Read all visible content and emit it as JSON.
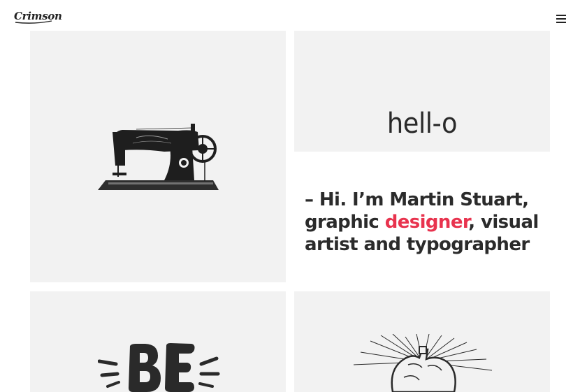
{
  "header": {
    "logo_text": "Crimson",
    "menu_icon": "hamburger-menu-icon"
  },
  "tiles": {
    "hello": {
      "text": "hell-o"
    },
    "sewing": {
      "image": "sewing-machine-illustration"
    },
    "be": {
      "lettering": "BE"
    },
    "heart": {
      "image": "anatomical-heart-illustration"
    }
  },
  "intro": {
    "before": "– Hi. I’m Martin Stuart, graphic ",
    "highlight": "designer",
    "after": ", visual artist and typographer"
  },
  "colors": {
    "accent": "#e8334e",
    "tile_bg": "#f2f2f2",
    "text": "#2b2b2b"
  }
}
